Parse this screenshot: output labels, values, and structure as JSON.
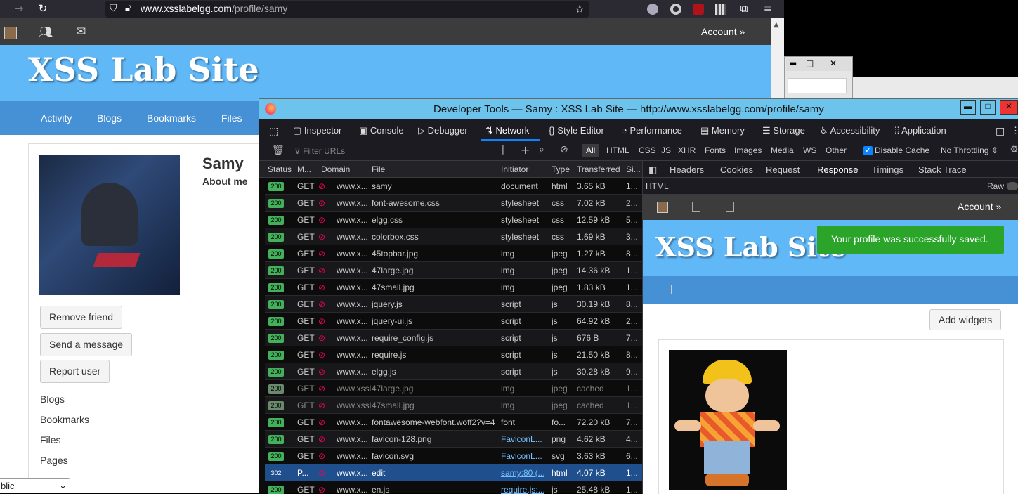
{
  "browser": {
    "url_domain": "www.xsslabelgg.com",
    "url_path": "/profile/samy"
  },
  "site": {
    "title": "XSS Lab Site",
    "account_label": "Account »",
    "nav": [
      "Activity",
      "Blogs",
      "Bookmarks",
      "Files"
    ]
  },
  "profile": {
    "name": "Samy",
    "about_label": "About me",
    "buttons": [
      "Remove friend",
      "Send a message",
      "Report user"
    ],
    "links": [
      "Blogs",
      "Bookmarks",
      "Files",
      "Pages"
    ],
    "select_value": "blic"
  },
  "devtools": {
    "title": "Developer Tools — Samy : XSS Lab Site — http://www.xsslabelgg.com/profile/samy",
    "tabs": [
      "Inspector",
      "Console",
      "Debugger",
      "Network",
      "Style Editor",
      "Performance",
      "Memory",
      "Storage",
      "Accessibility",
      "Application"
    ],
    "filter_placeholder": "Filter URLs",
    "types": [
      "All",
      "HTML",
      "CSS",
      "JS",
      "XHR",
      "Fonts",
      "Images",
      "Media",
      "WS",
      "Other"
    ],
    "disable_cache": "Disable Cache",
    "throttling": "No Throttling ⇕",
    "columns": [
      "Status",
      "M...",
      "Domain",
      "File",
      "Initiator",
      "Type",
      "Transferred",
      "Si..."
    ],
    "rows": [
      {
        "status": "200",
        "method": "GET",
        "domain": "www.x...",
        "file": "samy",
        "initiator": "document",
        "type": "html",
        "transferred": "3.65 kB",
        "size": "1..."
      },
      {
        "status": "200",
        "method": "GET",
        "domain": "www.x...",
        "file": "font-awesome.css",
        "initiator": "stylesheet",
        "type": "css",
        "transferred": "7.02 kB",
        "size": "2..."
      },
      {
        "status": "200",
        "method": "GET",
        "domain": "www.x...",
        "file": "elgg.css",
        "initiator": "stylesheet",
        "type": "css",
        "transferred": "12.59 kB",
        "size": "5..."
      },
      {
        "status": "200",
        "method": "GET",
        "domain": "www.x...",
        "file": "colorbox.css",
        "initiator": "stylesheet",
        "type": "css",
        "transferred": "1.69 kB",
        "size": "3..."
      },
      {
        "status": "200",
        "method": "GET",
        "domain": "www.x...",
        "file": "45topbar.jpg",
        "initiator": "img",
        "type": "jpeg",
        "transferred": "1.27 kB",
        "size": "8..."
      },
      {
        "status": "200",
        "method": "GET",
        "domain": "www.x...",
        "file": "47large.jpg",
        "initiator": "img",
        "type": "jpeg",
        "transferred": "14.36 kB",
        "size": "1..."
      },
      {
        "status": "200",
        "method": "GET",
        "domain": "www.x...",
        "file": "47small.jpg",
        "initiator": "img",
        "type": "jpeg",
        "transferred": "1.83 kB",
        "size": "1..."
      },
      {
        "status": "200",
        "method": "GET",
        "domain": "www.x...",
        "file": "jquery.js",
        "initiator": "script",
        "type": "js",
        "transferred": "30.19 kB",
        "size": "8..."
      },
      {
        "status": "200",
        "method": "GET",
        "domain": "www.x...",
        "file": "jquery-ui.js",
        "initiator": "script",
        "type": "js",
        "transferred": "64.92 kB",
        "size": "2..."
      },
      {
        "status": "200",
        "method": "GET",
        "domain": "www.x...",
        "file": "require_config.js",
        "initiator": "script",
        "type": "js",
        "transferred": "676 B",
        "size": "7..."
      },
      {
        "status": "200",
        "method": "GET",
        "domain": "www.x...",
        "file": "require.js",
        "initiator": "script",
        "type": "js",
        "transferred": "21.50 kB",
        "size": "8..."
      },
      {
        "status": "200",
        "method": "GET",
        "domain": "www.x...",
        "file": "elgg.js",
        "initiator": "script",
        "type": "js",
        "transferred": "30.28 kB",
        "size": "9..."
      },
      {
        "status": "200",
        "method": "GET",
        "domain": "www.xssl...",
        "file": "47large.jpg",
        "initiator": "img",
        "type": "jpeg",
        "transferred": "cached",
        "size": "1..."
      },
      {
        "status": "200",
        "method": "GET",
        "domain": "www.xssl...",
        "file": "47small.jpg",
        "initiator": "img",
        "type": "jpeg",
        "transferred": "cached",
        "size": "1..."
      },
      {
        "status": "200",
        "method": "GET",
        "domain": "www.x...",
        "file": "fontawesome-webfont.woff2?v=4",
        "initiator": "font",
        "type": "fo...",
        "transferred": "72.20 kB",
        "size": "7..."
      },
      {
        "status": "200",
        "method": "GET",
        "domain": "www.x...",
        "file": "favicon-128.png",
        "initiator": "FaviconL...",
        "type": "png",
        "transferred": "4.62 kB",
        "size": "4..."
      },
      {
        "status": "200",
        "method": "GET",
        "domain": "www.x...",
        "file": "favicon.svg",
        "initiator": "FaviconL...",
        "type": "svg",
        "transferred": "3.63 kB",
        "size": "6..."
      },
      {
        "status": "302",
        "method": "P...",
        "domain": "www.x...",
        "file": "edit",
        "initiator": "samy:80 (...",
        "type": "html",
        "transferred": "4.07 kB",
        "size": "1..."
      },
      {
        "status": "200",
        "method": "GET",
        "domain": "www.x...",
        "file": "en.js",
        "initiator": "require.js:...",
        "type": "js",
        "transferred": "25.48 kB",
        "size": "1..."
      }
    ],
    "detail_tabs": [
      "Headers",
      "Cookies",
      "Request",
      "Response",
      "Timings",
      "Stack Trace"
    ],
    "html_label": "HTML",
    "raw_label": "Raw",
    "preview": {
      "account_label": "Account »",
      "title": "XSS Lab Site",
      "toast": "Your profile was successfully saved.",
      "add_widgets": "Add widgets"
    }
  }
}
